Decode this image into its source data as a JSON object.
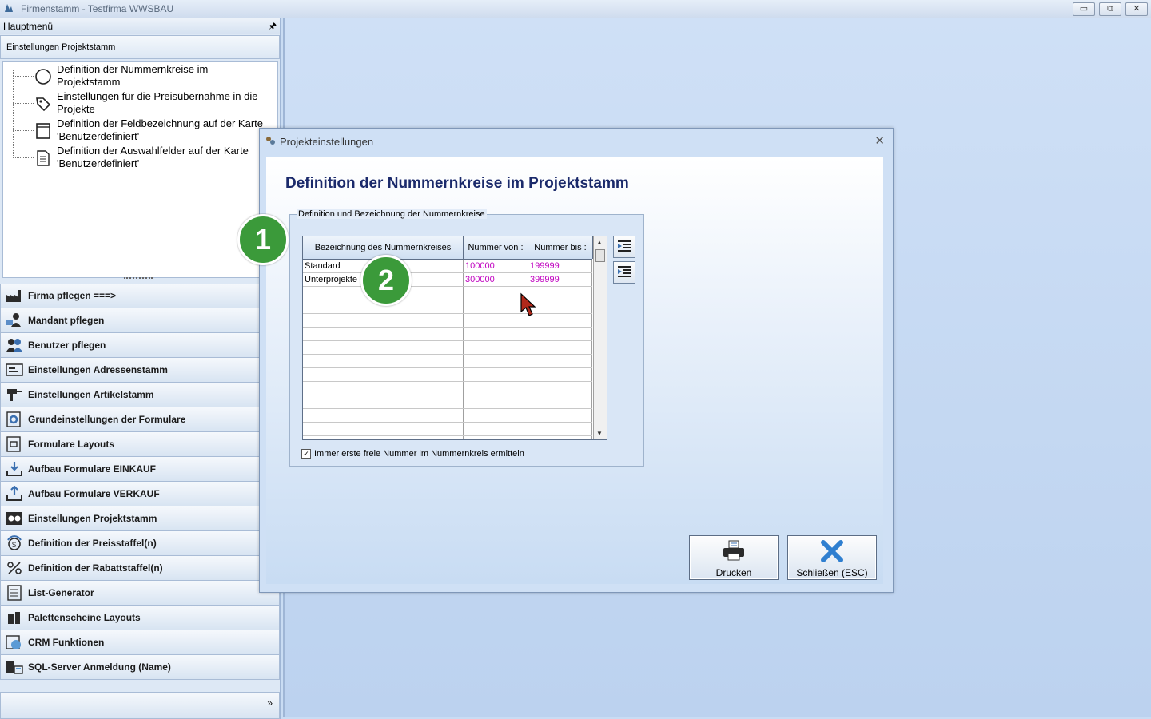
{
  "window": {
    "title": "Firmenstamm - Testfirma WWSBAU",
    "buttons": {
      "minimize": "▭",
      "restore": "⧉",
      "close": "✕"
    }
  },
  "sidebar": {
    "header": "Hauptmenü",
    "pin": "🖈",
    "section": "Einstellungen Projektstamm",
    "tree": [
      {
        "label": "Definition der Nummernkreise im Projektstamm",
        "icon": "circle-icon"
      },
      {
        "label": "Einstellungen für die Preisübernahme in die Projekte",
        "icon": "tag-icon"
      },
      {
        "label": "Definition der Feldbezeichnung auf der Karte 'Benutzerdefiniert'",
        "icon": "form-icon"
      },
      {
        "label": "Definition der Auswahlfelder auf der Karte 'Benutzerdefiniert'",
        "icon": "document-icon"
      }
    ],
    "menu": [
      {
        "label": "Firma pflegen   ===>",
        "icon": "factory-icon"
      },
      {
        "label": "Mandant pflegen",
        "icon": "user-computer-icon"
      },
      {
        "label": "Benutzer pflegen",
        "icon": "users-icon"
      },
      {
        "label": "Einstellungen Adressenstamm",
        "icon": "address-card-icon"
      },
      {
        "label": "Einstellungen Artikelstamm",
        "icon": "drill-icon"
      },
      {
        "label": "Grundeinstellungen der Formulare",
        "icon": "gear-form-icon"
      },
      {
        "label": "Formulare Layouts",
        "icon": "layout-icon"
      },
      {
        "label": "Aufbau Formulare EINKAUF",
        "icon": "inbox-download-icon"
      },
      {
        "label": "Aufbau Formulare VERKAUF",
        "icon": "inbox-upload-icon"
      },
      {
        "label": "Einstellungen Projektstamm",
        "icon": "project-icon"
      },
      {
        "label": "Definition der Preisstaffel(n)",
        "icon": "price-icon"
      },
      {
        "label": "Definition der Rabattstaffel(n)",
        "icon": "percent-icon"
      },
      {
        "label": "List-Generator",
        "icon": "list-icon"
      },
      {
        "label": "Palettenscheine Layouts",
        "icon": "pallet-icon"
      },
      {
        "label": "CRM Funktionen",
        "icon": "crm-icon"
      },
      {
        "label": "SQL-Server Anmeldung (Name)",
        "icon": "server-icon"
      }
    ],
    "footer_chevron": "»"
  },
  "dialog": {
    "title": "Projekteinstellungen",
    "close": "✕",
    "heading": "Definition der Nummernkreise im Projektstamm",
    "group_label": "Definition und Bezeichnung der Nummernkreise",
    "columns": [
      "Bezeichnung des Nummernkreises",
      "Nummer von :",
      "Nummer bis :"
    ],
    "rows": [
      [
        "Standard",
        "100000",
        "199999"
      ],
      [
        "Unterprojekte",
        "300000",
        "399999"
      ]
    ],
    "empty_rows": 12,
    "checkbox": {
      "label": "Immer erste freie Nummer im Nummernkreis ermitteln",
      "checked": true,
      "mark": "✓"
    },
    "buttons": {
      "print": "Drucken",
      "close": "Schließen (ESC)"
    }
  },
  "badges": [
    "1",
    "2"
  ],
  "colors": {
    "accent_green": "#3b9a3a",
    "number_magenta": "#c000c0",
    "heading_navy": "#1b2a6b"
  }
}
